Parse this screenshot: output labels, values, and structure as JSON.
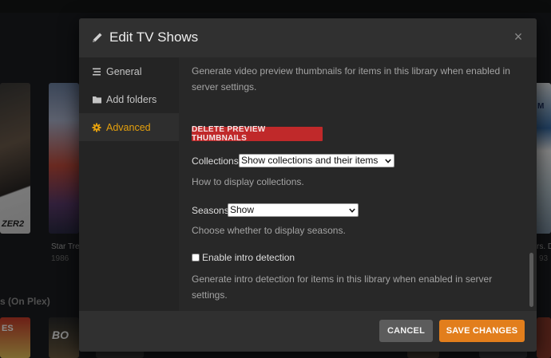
{
  "background": {
    "posters": [
      {
        "tag": "ZER2"
      },
      {
        "title": "Star Tre",
        "year": "1986"
      },
      {
        "tag": "M"
      }
    ],
    "right_caption": {
      "title": "rs. D",
      "year": "93"
    },
    "section_heading": "s (On Plex)",
    "row_tags": [
      "ES",
      "BO"
    ]
  },
  "modal": {
    "title": "Edit TV Shows",
    "close_label": "×",
    "sidebar": {
      "items": [
        {
          "label": "General",
          "icon": "list-icon",
          "active": false
        },
        {
          "label": "Add folders",
          "icon": "folder-icon",
          "active": false
        },
        {
          "label": "Advanced",
          "icon": "gear-icon",
          "active": true
        }
      ]
    },
    "content": {
      "preview_description": "Generate video preview thumbnails for items in this library when enabled in server settings.",
      "delete_preview_label": "DELETE PREVIEW THUMBNAILS",
      "collections": {
        "label": "Collections",
        "selected": "Show collections and their items",
        "help": "How to display collections."
      },
      "seasons": {
        "label": "Seasons",
        "selected": "Show",
        "help": "Choose whether to display seasons."
      },
      "intro_detection": {
        "label": "Enable intro detection",
        "checked": false,
        "help": "Generate intro detection for items in this library when enabled in server settings."
      }
    },
    "footer": {
      "cancel_label": "CANCEL",
      "save_label": "SAVE CHANGES"
    }
  },
  "colors": {
    "accent": "#e5a00d",
    "save": "#e27e1c",
    "danger": "#c0292a",
    "cancel": "#5c5c5c"
  }
}
